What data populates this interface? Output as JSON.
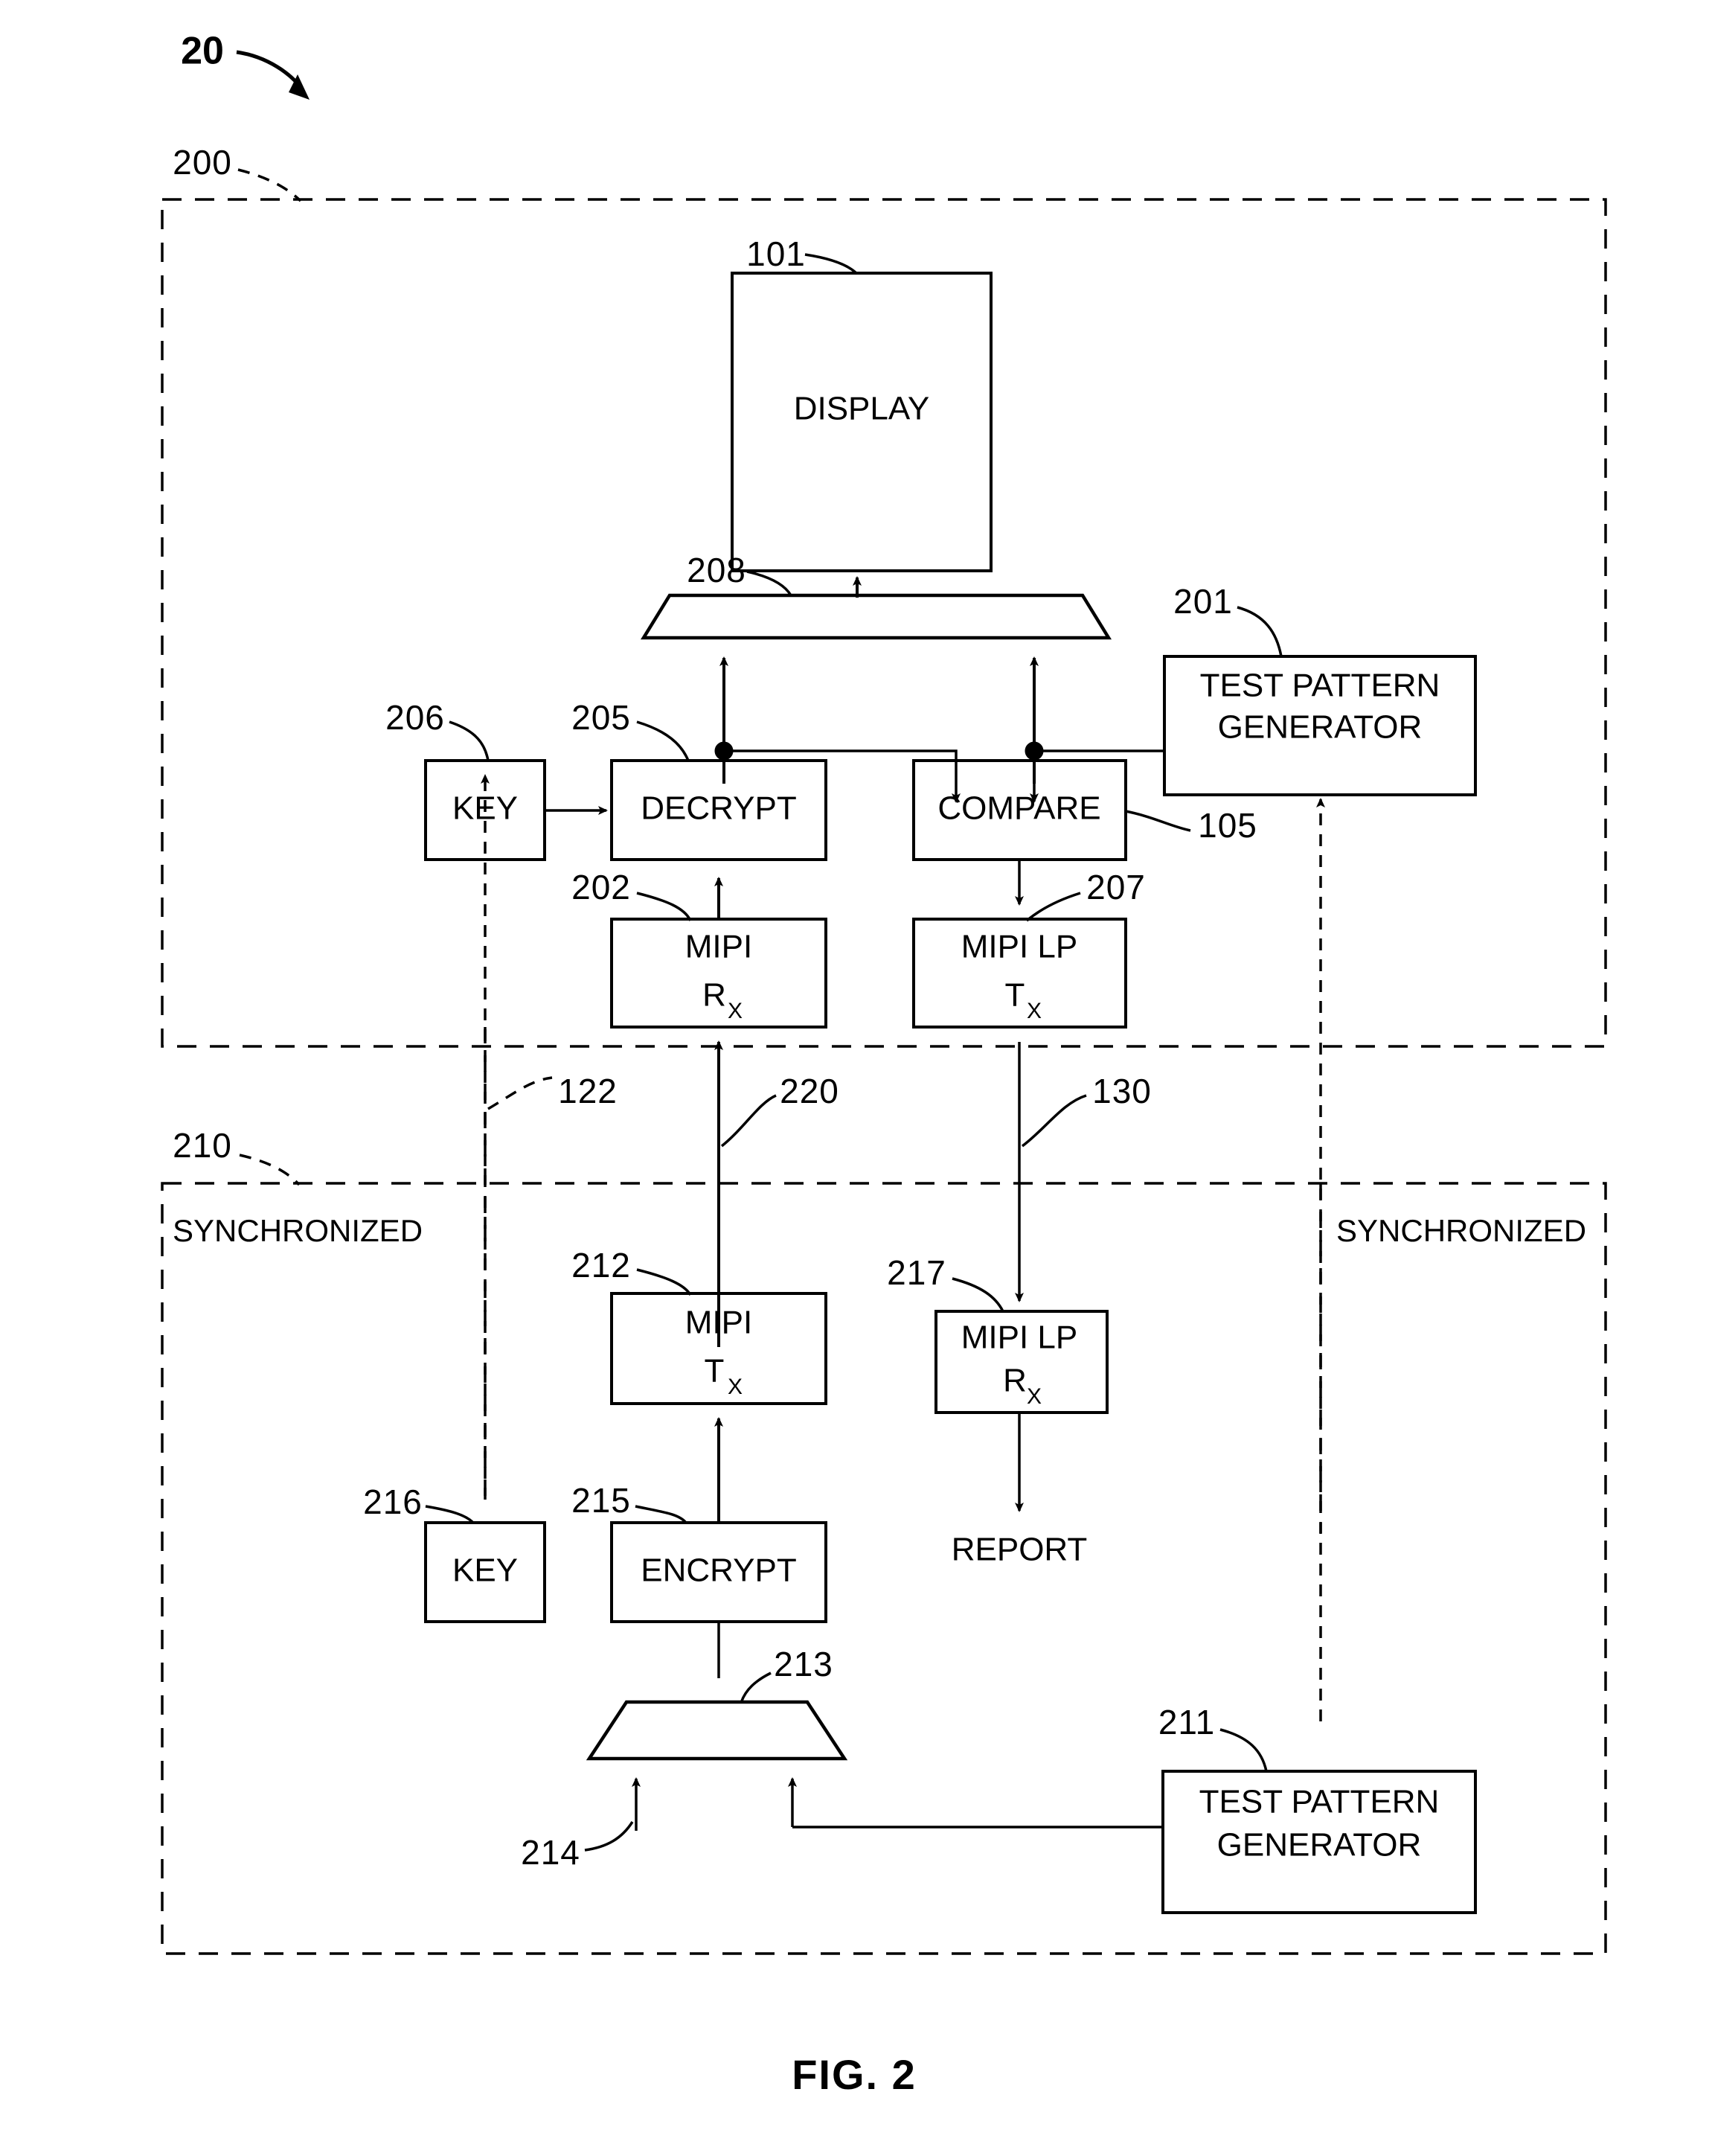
{
  "figure": {
    "caption": "FIG. 2",
    "system_ref": "20"
  },
  "zones": [
    {
      "ref": "200",
      "label": ""
    },
    {
      "ref": "210",
      "label_left": "SYNCHRONIZED",
      "label_right": "SYNCHRONIZED"
    }
  ],
  "zone_labels": {
    "left": "SYNCHRONIZED",
    "right": "SYNCHRONIZED"
  },
  "blocks": {
    "display": {
      "label": "DISPLAY",
      "ref": "101"
    },
    "mux_top": {
      "ref": "208"
    },
    "test_pattern_generator_top": {
      "line1": "TEST PATTERN",
      "line2": "GENERATOR",
      "ref": "201"
    },
    "key_top": {
      "label": "KEY",
      "ref": "206"
    },
    "decrypt": {
      "label": "DECRYPT",
      "ref": "205"
    },
    "compare": {
      "label": "COMPARE",
      "ref": "105"
    },
    "mipi_rx": {
      "line1": "MIPI",
      "line2": "R",
      "sub2": "X",
      "ref": "202"
    },
    "mipi_lp_tx": {
      "line1": "MIPI LP",
      "line2": "T",
      "sub2": "X",
      "ref": "207"
    },
    "mipi_tx": {
      "line1": "MIPI",
      "line2": "T",
      "sub2": "X",
      "ref": "212"
    },
    "mipi_lp_rx": {
      "line1": "MIPI LP",
      "line2": "R",
      "sub2": "X",
      "ref": "217"
    },
    "key_bottom": {
      "label": "KEY",
      "ref": "216"
    },
    "encrypt": {
      "label": "ENCRYPT",
      "ref": "215"
    },
    "mux_bottom": {
      "ref": "213"
    },
    "test_pattern_generator_bottom": {
      "line1": "TEST PATTERN",
      "line2": "GENERATOR",
      "ref": "211"
    },
    "report": {
      "label": "REPORT"
    }
  },
  "link_refs": {
    "key_channel": "122",
    "data_channel": "220",
    "report_channel": "130",
    "video_input": "214"
  },
  "colors": {
    "ink": "#000000",
    "background": "#ffffff"
  }
}
